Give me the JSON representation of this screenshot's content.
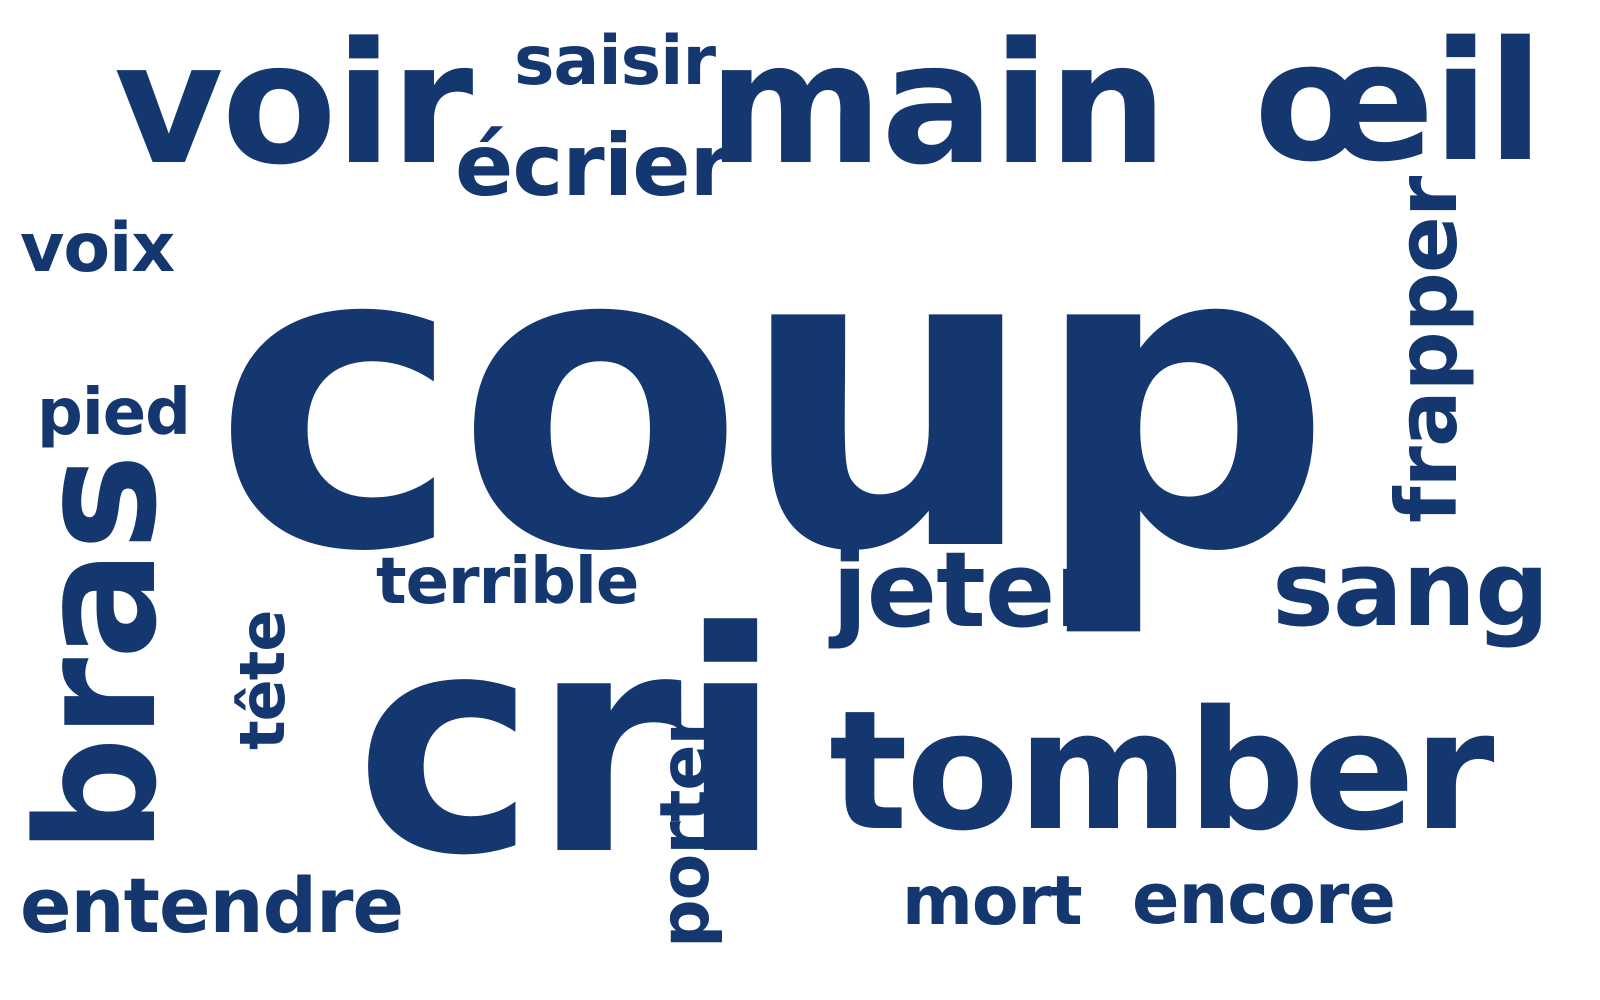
{
  "word_cloud": {
    "color": "#14376f",
    "background": "#ffffff",
    "words": [
      {
        "id": "coup",
        "text": "coup"
      },
      {
        "id": "cri",
        "text": "cri"
      },
      {
        "id": "main",
        "text": "main"
      },
      {
        "id": "voir",
        "text": "voir"
      },
      {
        "id": "oeil",
        "text": "œil"
      },
      {
        "id": "tomber",
        "text": "tomber"
      },
      {
        "id": "bras",
        "text": "bras"
      },
      {
        "id": "jeter",
        "text": "jeter"
      },
      {
        "id": "sang",
        "text": "sang"
      },
      {
        "id": "ecrier",
        "text": "écrier"
      },
      {
        "id": "frapper",
        "text": "frapper"
      },
      {
        "id": "entendre",
        "text": "entendre"
      },
      {
        "id": "terrible",
        "text": "terrible"
      },
      {
        "id": "encore",
        "text": "encore"
      },
      {
        "id": "mort",
        "text": "mort"
      },
      {
        "id": "porter",
        "text": "porter"
      },
      {
        "id": "voix",
        "text": "voix"
      },
      {
        "id": "saisir",
        "text": "saisir"
      },
      {
        "id": "pied",
        "text": "pied"
      },
      {
        "id": "tete",
        "text": "tête"
      }
    ]
  }
}
